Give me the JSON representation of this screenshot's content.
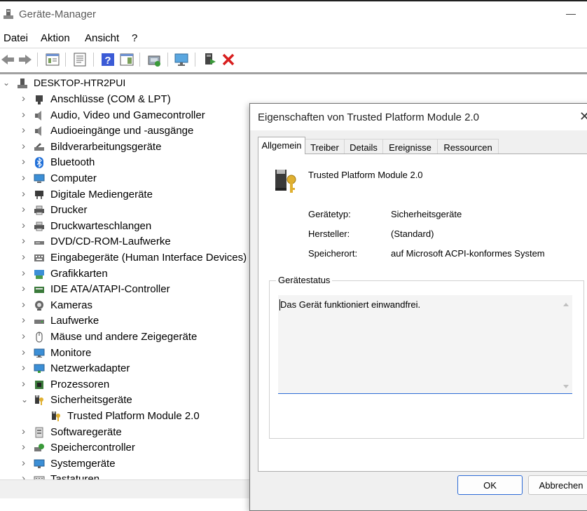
{
  "window": {
    "title": "Geräte-Manager"
  },
  "menu": [
    "Datei",
    "Aktion",
    "Ansicht",
    "?"
  ],
  "toolbar": [
    "back-icon",
    "forward-icon",
    "properties-icon",
    "update-icon",
    "help-icon",
    "view-icon",
    "scan-icon",
    "monitor-icon",
    "enable-icon",
    "uninstall-icon"
  ],
  "tree": {
    "root": "DESKTOP-HTR2PUI",
    "items": [
      {
        "label": "Anschlüsse (COM & LPT)",
        "icon": "port-icon",
        "expanded": false
      },
      {
        "label": "Audio, Video und Gamecontroller",
        "icon": "speaker-icon",
        "expanded": false
      },
      {
        "label": "Audioeingänge und -ausgänge",
        "icon": "speaker-icon",
        "expanded": false
      },
      {
        "label": "Bildverarbeitungsgeräte",
        "icon": "scanner-icon",
        "expanded": false
      },
      {
        "label": "Bluetooth",
        "icon": "bluetooth-icon",
        "expanded": false
      },
      {
        "label": "Computer",
        "icon": "computer-icon",
        "expanded": false
      },
      {
        "label": "Digitale Mediengeräte",
        "icon": "media-icon",
        "expanded": false
      },
      {
        "label": "Drucker",
        "icon": "printer-icon",
        "expanded": false
      },
      {
        "label": "Druckwarteschlangen",
        "icon": "printer-icon",
        "expanded": false
      },
      {
        "label": "DVD/CD-ROM-Laufwerke",
        "icon": "dvd-icon",
        "expanded": false
      },
      {
        "label": "Eingabegeräte (Human Interface Devices)",
        "icon": "hid-icon",
        "expanded": false
      },
      {
        "label": "Grafikkarten",
        "icon": "display-adapter-icon",
        "expanded": false
      },
      {
        "label": "IDE ATA/ATAPI-Controller",
        "icon": "ide-icon",
        "expanded": false
      },
      {
        "label": "Kameras",
        "icon": "camera-icon",
        "expanded": false
      },
      {
        "label": "Laufwerke",
        "icon": "disk-icon",
        "expanded": false
      },
      {
        "label": "Mäuse und andere Zeigegeräte",
        "icon": "mouse-icon",
        "expanded": false
      },
      {
        "label": "Monitore",
        "icon": "monitor-icon",
        "expanded": false
      },
      {
        "label": "Netzwerkadapter",
        "icon": "network-icon",
        "expanded": false
      },
      {
        "label": "Prozessoren",
        "icon": "processor-icon",
        "expanded": false
      },
      {
        "label": "Sicherheitsgeräte",
        "icon": "security-icon",
        "expanded": true
      },
      {
        "label": "Trusted Platform Module 2.0",
        "icon": "tpm-icon",
        "child": true
      },
      {
        "label": "Softwaregeräte",
        "icon": "software-icon",
        "expanded": false
      },
      {
        "label": "Speichercontroller",
        "icon": "storage-icon",
        "expanded": false
      },
      {
        "label": "Systemgeräte",
        "icon": "system-icon",
        "expanded": false
      },
      {
        "label": "Tastaturen",
        "icon": "keyboard-icon",
        "expanded": false
      }
    ]
  },
  "dialog": {
    "title": "Eigenschaften von Trusted Platform Module 2.0",
    "tabs": [
      "Allgemein",
      "Treiber",
      "Details",
      "Ereignisse",
      "Ressourcen"
    ],
    "active_tab": "Allgemein",
    "device_name": "Trusted Platform Module 2.0",
    "props": [
      {
        "label": "Gerätetyp:",
        "value": "Sicherheitsgeräte"
      },
      {
        "label": "Hersteller:",
        "value": "(Standard)"
      },
      {
        "label": "Speicherort:",
        "value": "auf Microsoft ACPI-konformes System"
      }
    ],
    "status_legend": "Gerätestatus",
    "status_text": "Das Gerät funktioniert einwandfrei.",
    "ok": "OK",
    "cancel": "Abbrechen"
  },
  "colors": {
    "accent": "#2d6bd6",
    "uninstall": "#d81e1e",
    "help": "#3b5bd6"
  }
}
